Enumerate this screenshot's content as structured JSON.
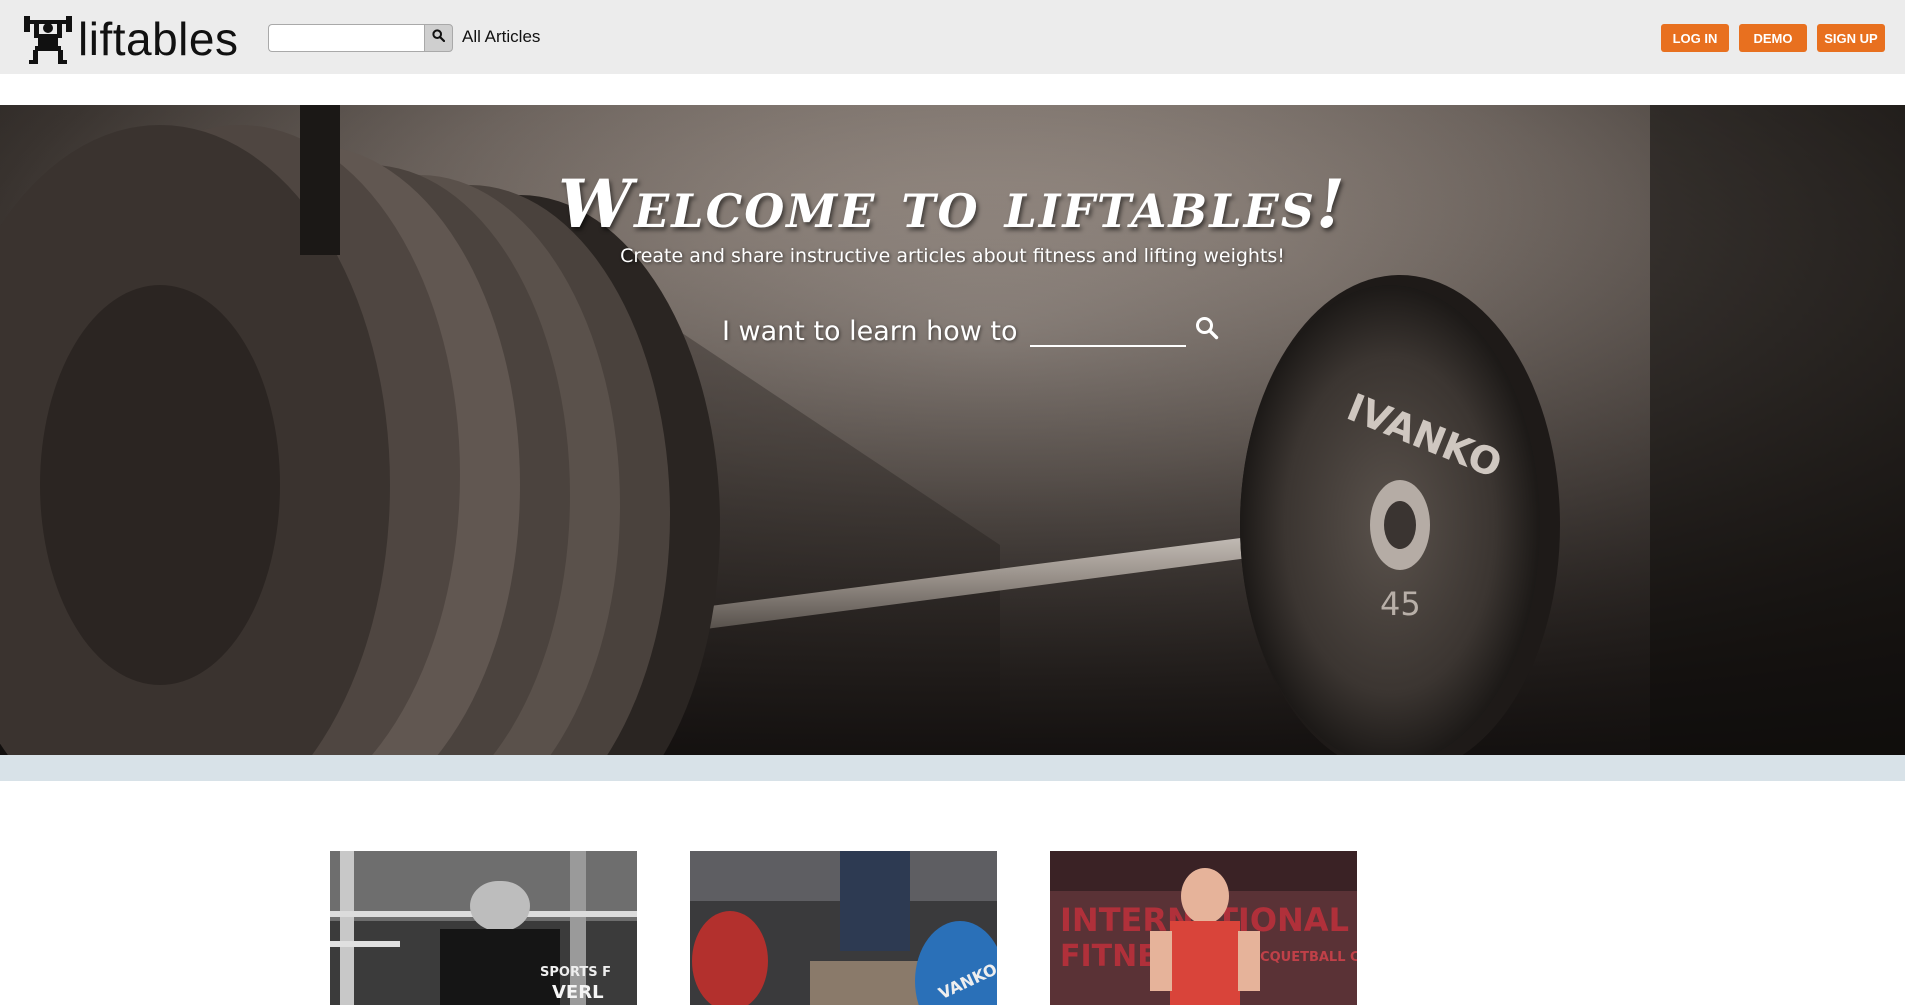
{
  "header": {
    "logo_text": "liftables",
    "search": {
      "placeholder": "",
      "value": ""
    },
    "all_articles_label": "All Articles",
    "buttons": {
      "login": "LOG IN",
      "demo": "DEMO",
      "signup": "SIGN UP"
    }
  },
  "hero": {
    "title": "Welcome to liftables!",
    "subtitle": "Create and share instructive articles about fitness and lifting weights!",
    "learn_label": "I want to learn how to",
    "learn_input": {
      "placeholder": "",
      "value": ""
    },
    "plate_brand": "IVANKO",
    "plate_weight": "45"
  },
  "articles": [
    {
      "image": "athlete-squat-photo",
      "visible_text": [
        "SPORTS F",
        "VERL"
      ]
    },
    {
      "image": "athlete-bench-press-photo",
      "visible_text": [
        "VANKO"
      ]
    },
    {
      "image": "athlete-deadlift-photo",
      "visible_text": [
        "INTERNATIONAL",
        "FITNESS",
        "RACQUETBALL CENTERS"
      ]
    }
  ],
  "colors": {
    "accent": "#e8701f",
    "header_bg": "#ececec",
    "band": "#d8e2e8"
  }
}
